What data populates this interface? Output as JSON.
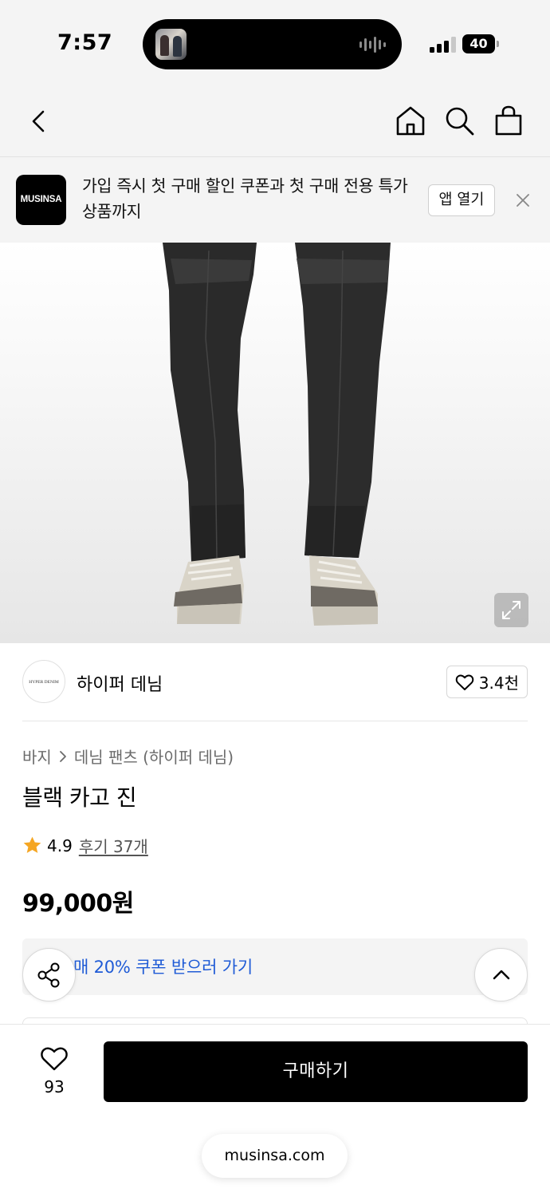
{
  "status_bar": {
    "time": "7:57",
    "battery": "40"
  },
  "nav": {
    "icons": [
      "back-icon",
      "home-icon",
      "search-icon",
      "shopping-bag-icon"
    ]
  },
  "banner": {
    "logo_text": "MUSINSA",
    "message": "가입 즉시 첫 구매 할인 쿠폰과 첫 구매 전용 특가 상품까지",
    "open_app_label": "앱 열기"
  },
  "product_image": {
    "icons": [
      "expand-icon"
    ]
  },
  "brand": {
    "logo_text": "HYPER DENIM",
    "name": "하이퍼 데님",
    "like_count": "3.4천"
  },
  "product": {
    "breadcrumb": [
      "바지",
      "데님 팬츠 (하이퍼 데님)"
    ],
    "title": "블랙 카고 진",
    "rating": "4.9",
    "review_link": "후기 37개",
    "price": "99,000원",
    "coupon_text": "매 20% 쿠폰 받으러 가기"
  },
  "bottom_bar": {
    "wish_count": "93",
    "buy_label": "구매하기"
  },
  "browser": {
    "url": "musinsa.com"
  },
  "colors": {
    "accent_link": "#1f5bd6",
    "star": "#f5a623",
    "buy_button": "#000000"
  }
}
